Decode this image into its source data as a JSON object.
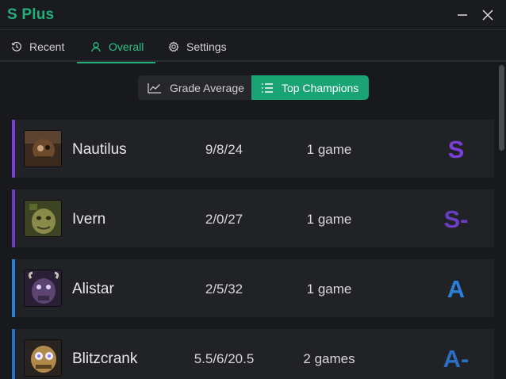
{
  "app": {
    "title": "S Plus"
  },
  "window_controls": {
    "minimize_icon": "minimize-icon",
    "close_icon": "close-icon"
  },
  "tabs": [
    {
      "label": "Recent",
      "icon": "history-icon",
      "active": false
    },
    {
      "label": "Overall",
      "icon": "user-icon",
      "active": true
    },
    {
      "label": "Settings",
      "icon": "gear-icon",
      "active": false
    }
  ],
  "view_toggle": {
    "grade_average": {
      "label": "Grade Average",
      "icon": "line-chart-icon",
      "active": false
    },
    "top_champions": {
      "label": "Top Champions",
      "icon": "list-icon",
      "active": true
    }
  },
  "champions": [
    {
      "name": "Nautilus",
      "kda": "9/8/24",
      "games": "1 game",
      "grade": "S",
      "accent": "#7a3fd6",
      "grade_color": "#7a3fd6"
    },
    {
      "name": "Ivern",
      "kda": "2/0/27",
      "games": "1 game",
      "grade": "S-",
      "accent": "#6b3cc4",
      "grade_color": "#6b3cc4"
    },
    {
      "name": "Alistar",
      "kda": "2/5/32",
      "games": "1 game",
      "grade": "A",
      "accent": "#2a7fd8",
      "grade_color": "#2a7fd8"
    },
    {
      "name": "Blitzcrank",
      "kda": "5.5/6/20.5",
      "games": "2 games",
      "grade": "A-",
      "accent": "#2a6fc4",
      "grade_color": "#2a6fc4"
    }
  ],
  "colors": {
    "brand": "#21b07c",
    "background": "#18191c",
    "card": "#212226"
  }
}
